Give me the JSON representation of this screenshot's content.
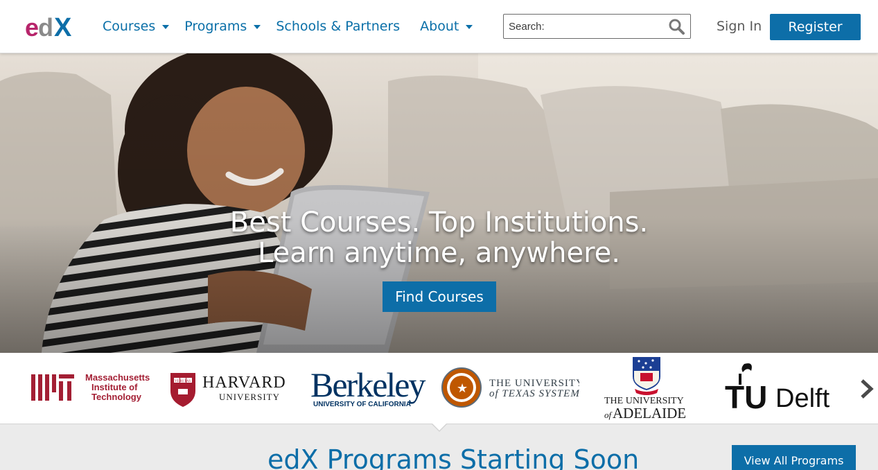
{
  "brand": {
    "logo_text": "edX",
    "colors": {
      "accent": "#0d6ea8",
      "logo_e": "#b7256b",
      "logo_d": "#8a8a8a",
      "logo_x": "#0d6ea8"
    }
  },
  "header": {
    "nav": [
      {
        "label": "Courses",
        "dropdown": true
      },
      {
        "label": "Programs",
        "dropdown": true
      },
      {
        "label": "Schools & Partners",
        "dropdown": false
      },
      {
        "label": "About",
        "dropdown": true
      }
    ],
    "search": {
      "placeholder": "Search:",
      "value": "",
      "icon": "search-icon"
    },
    "sign_in": "Sign In",
    "register": "Register"
  },
  "hero": {
    "line1": "Best Courses. Top Institutions.",
    "line2": "Learn anytime, anywhere.",
    "cta": "Find Courses"
  },
  "partners": {
    "items": [
      {
        "name": "MIT",
        "lines": [
          "Massachusetts",
          "Institute of",
          "Technology"
        ]
      },
      {
        "name": "HARVARD",
        "sub": "UNIVERSITY",
        "shield": "VE RI TAS"
      },
      {
        "name": "Berkeley",
        "sub": "UNIVERSITY OF CALIFORNIA"
      },
      {
        "name": "THE UNIVERSITY",
        "sub": "of TEXAS SYSTEM"
      },
      {
        "name": "THE UNIVERSITY",
        "sub_of": "of",
        "sub": "ADELAIDE"
      },
      {
        "name": "TU",
        "sub": "Delft"
      }
    ],
    "next_icon": "chevron-right-icon"
  },
  "programs": {
    "title": "edX Programs Starting Soon",
    "view_all": "View All Programs"
  }
}
